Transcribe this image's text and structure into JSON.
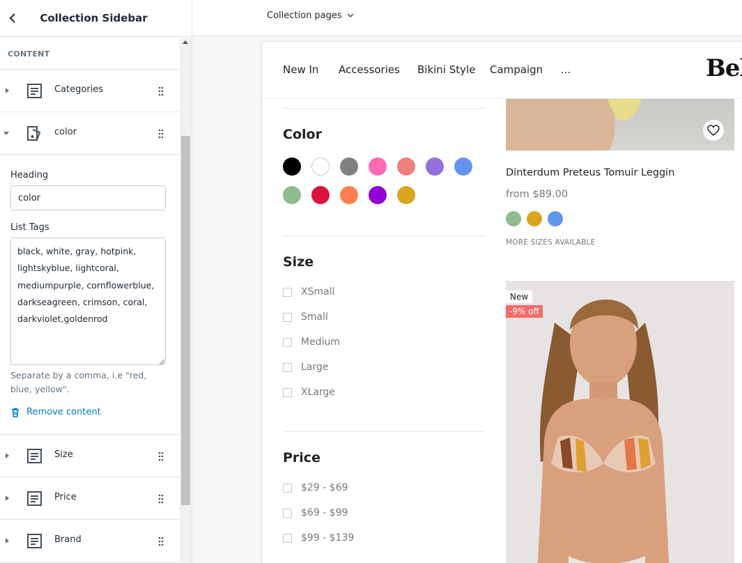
{
  "editor": {
    "title": "Collection Sidebar",
    "section_label": "CONTENT",
    "blocks": [
      {
        "label": "Categories"
      },
      {
        "label": "color"
      },
      {
        "label": "Size"
      },
      {
        "label": "Price"
      },
      {
        "label": "Brand"
      }
    ],
    "settings": {
      "heading_label": "Heading",
      "heading_value": "color",
      "tags_label": "List Tags",
      "tags_value": "black, white, gray, hotpink,\nlightskyblue, lightcoral,\nmediumpurple, cornflowerblue,\ndarkseagreen, crimson, coral,\ndarkviolet,goldenrod",
      "help": "Separate by a comma, i.e \"red, blue, yellow\".",
      "remove_label": "Remove content"
    }
  },
  "topbar": {
    "page_selector": "Collection pages"
  },
  "store": {
    "nav": [
      "New In",
      "Accessories",
      "Bikini Style",
      "Campaign",
      "..."
    ],
    "logo": "Bel",
    "filters": {
      "color_title": "Color",
      "colors": [
        "#000000",
        "#ffffff",
        "#808080",
        "#ff69b4",
        "#f08080",
        "#9370db",
        "#6495ed",
        "#8fbc8f",
        "#dc143c",
        "#ff7f50",
        "#9400d3",
        "#daa520"
      ],
      "size_title": "Size",
      "sizes": [
        "XSmall",
        "Small",
        "Medium",
        "Large",
        "XLarge"
      ],
      "price_title": "Price",
      "prices": [
        "$29 - $69",
        "$69 - $99",
        "$99 - $139"
      ]
    },
    "product": {
      "title": "Dinterdum Preteus Tomuir Leggin",
      "price": "from $89.00",
      "swatches": [
        "#8fbc8f",
        "#daa520",
        "#6495ed"
      ],
      "sizes_note": "MORE SIZES AVAILABLE"
    },
    "product2": {
      "badge_new": "New",
      "badge_off": "-9% off"
    }
  }
}
